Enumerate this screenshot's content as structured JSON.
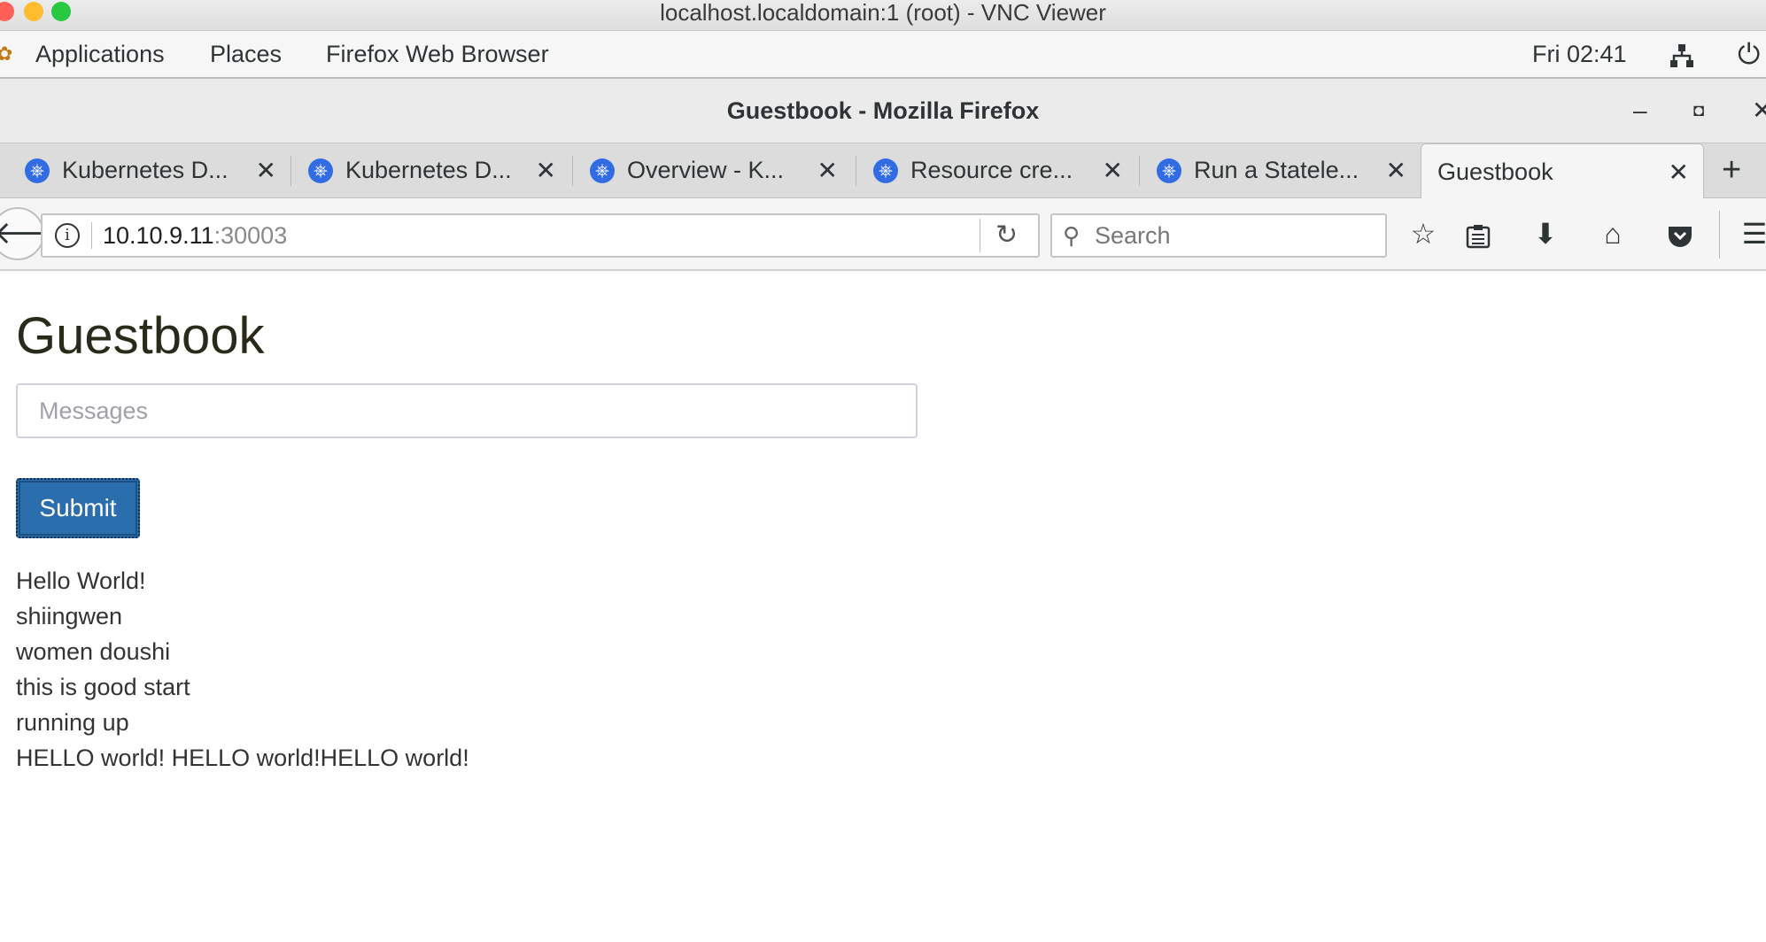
{
  "mac": {
    "title": "localhost.localdomain:1 (root) - VNC Viewer",
    "colors": {
      "close": "#ff5f57",
      "minimize": "#febc2e",
      "zoom": "#28c840"
    }
  },
  "panel": {
    "menus": [
      "Applications",
      "Places",
      "Firefox Web Browser"
    ],
    "clock": "Fri 02:41",
    "icons": [
      "network-icon",
      "power-icon"
    ]
  },
  "firefox": {
    "window_title": "Guestbook - Mozilla Firefox",
    "tabs": [
      {
        "label": "Kubernetes D...",
        "icon": "kubernetes-icon",
        "active": false
      },
      {
        "label": "Kubernetes D...",
        "icon": "kubernetes-icon",
        "active": false
      },
      {
        "label": "Overview - K...",
        "icon": "kubernetes-icon",
        "active": false
      },
      {
        "label": "Resource cre...",
        "icon": "kubernetes-icon",
        "active": false
      },
      {
        "label": "Run a Statele...",
        "icon": "kubernetes-icon",
        "active": false
      },
      {
        "label": "Guestbook",
        "icon": "",
        "active": true
      }
    ],
    "url": {
      "host": "10.10.9.11",
      "port": ":30003"
    },
    "search": {
      "placeholder": "Search"
    }
  },
  "page": {
    "heading": "Guestbook",
    "input_placeholder": "Messages",
    "submit_label": "Submit",
    "entries": [
      "Hello World!",
      "shiingwen",
      "women doushi",
      "this is good start",
      "running up",
      "HELLO world! HELLO world!HELLO world!"
    ],
    "accent": "#2a6ead"
  }
}
